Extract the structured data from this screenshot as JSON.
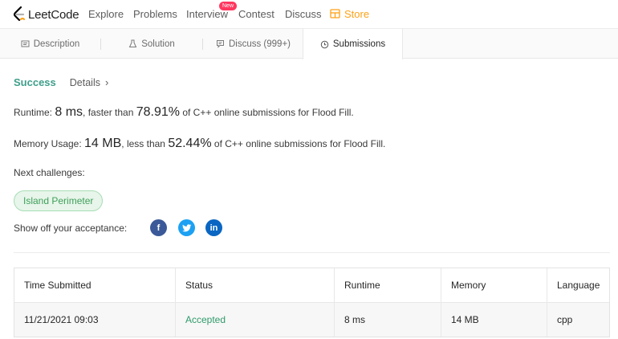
{
  "nav": {
    "logo_text": "LeetCode",
    "items": [
      "Explore",
      "Problems",
      "Interview",
      "Contest",
      "Discuss"
    ],
    "badge": "New",
    "store": "Store"
  },
  "tabs": [
    {
      "label": "Description",
      "icon": "description-icon"
    },
    {
      "label": "Solution",
      "icon": "flask-icon"
    },
    {
      "label": "Discuss (999+)",
      "icon": "comment-icon"
    },
    {
      "label": "Submissions",
      "icon": "clock-icon",
      "active": true
    }
  ],
  "result": {
    "status": "Success",
    "details": "Details",
    "runtime_prefix": "Runtime: ",
    "runtime_value": "8 ms",
    "runtime_mid": ", faster than ",
    "runtime_pct": "78.91%",
    "runtime_suffix": " of C++ online submissions for Flood Fill.",
    "memory_prefix": "Memory Usage: ",
    "memory_value": "14 MB",
    "memory_mid": ", less than ",
    "memory_pct": "52.44%",
    "memory_suffix": " of C++ online submissions for Flood Fill.",
    "next_label": "Next challenges:",
    "next_challenge": "Island Perimeter",
    "share_label": "Show off your acceptance:"
  },
  "table": {
    "headers": [
      "Time Submitted",
      "Status",
      "Runtime",
      "Memory",
      "Language"
    ],
    "rows": [
      [
        "11/21/2021 09:03",
        "Accepted",
        "8 ms",
        "14 MB",
        "cpp"
      ]
    ]
  },
  "colors": {
    "accent": "#ffa116",
    "success": "#3e9e8a",
    "facebook": "#3b5998",
    "twitter": "#1da1f2",
    "linkedin": "#0a66c2"
  }
}
